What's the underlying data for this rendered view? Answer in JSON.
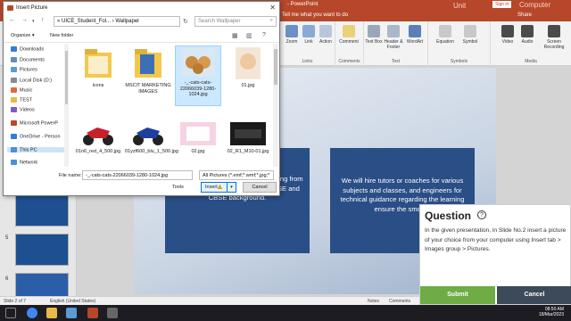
{
  "powerpoint": {
    "title": "- PowerPoint",
    "unit_text": "Unit",
    "brand_text": "Computer Education",
    "sign_in": "Sign in",
    "tell_me": "Tell me what you want to do",
    "share": "Share"
  },
  "ribbon": {
    "links_group": "Links",
    "comments_group": "Comments",
    "text_group": "Text",
    "symbols_group": "Symbols",
    "media_group": "Media",
    "buttons": {
      "zoom": "Zoom",
      "link": "Link",
      "action": "Action",
      "comment": "Comment",
      "textbox": "Text Box",
      "header_footer": "Header & Footer",
      "wordart": "WordArt",
      "equation": "Equation",
      "symbol": "Symbol",
      "video": "Video",
      "audio": "Audio",
      "screen_recording": "Screen Recording"
    }
  },
  "thumbnails": {
    "numbers": [
      "4",
      "5",
      "6"
    ]
  },
  "slide": {
    "left_text": "class mic aspirants of all ages, starting from Standard I to Standard XII from ICSE and CBSE background.",
    "right_text": "We will hire tutors or coaches for various subjects and classes, and engineers for technical guidance regarding the learning ensure the smooth"
  },
  "statusbar": {
    "slide_of": "Slide 2 of 7",
    "language": "English (United States)",
    "notes": "Notes",
    "comments": "Comments"
  },
  "taskbar": {
    "time": "08:50 AM",
    "date": "18/Mar/2023"
  },
  "dialog": {
    "title": "Insert Picture",
    "close_glyph": "✕",
    "address": "« UICE_Student_Fol... › Wallpaper",
    "search_placeholder": "Search Wallpaper",
    "organize": "Organize ▾",
    "new_folder": "New folder",
    "nav_items": [
      {
        "label": "Downloads",
        "color": "#2f7ed8"
      },
      {
        "label": "Documents",
        "color": "#6a8ab5"
      },
      {
        "label": "Pictures",
        "color": "#5a9bd4"
      },
      {
        "label": "Local Disk (D:)",
        "color": "#8a8a8a"
      },
      {
        "label": "Music",
        "color": "#e06a3a"
      },
      {
        "label": "TEST",
        "color": "#e9b949"
      },
      {
        "label": "Videos",
        "color": "#7a5cc7"
      },
      {
        "label": "Microsoft PowerP",
        "color": "#b7472a"
      },
      {
        "label": "OneDrive - Person",
        "color": "#2f7ed8"
      },
      {
        "label": "This PC",
        "color": "#4a90d9"
      },
      {
        "label": "Network",
        "color": "#4a90d9"
      }
    ],
    "files": [
      {
        "name": "icons"
      },
      {
        "name": "MSCIT MARKETING IMAGES"
      },
      {
        "name": "-_-cats-cats-22066039-1280-1024.jpg"
      },
      {
        "name": "01.jpg"
      },
      {
        "name": "01n6_red_4_500.jpg"
      },
      {
        "name": "01yzf600_blu_1_500.jpg"
      },
      {
        "name": "02.jpg"
      },
      {
        "name": "02_R1_M10-01.jpg"
      }
    ],
    "file_name_label": "File name:",
    "file_name_value": "-_-cats-cats-22066039-1280-1024.jpg",
    "filter_value": "All Pictures (*.emf;*.wmf;*.jpg;*",
    "tools": "Tools",
    "insert": "Insert",
    "cancel": "Cancel"
  },
  "question": {
    "title": "Question",
    "help": "?",
    "body": "In the given presentation, in Slide No.2 insert a picture of your choice from your computer using Insert tab > Images group > Pictures.",
    "submit": "Submit",
    "cancel": "Cancel"
  },
  "colors": {
    "ppt_red": "#b7472a",
    "slide_box": "#2a4e86",
    "submit_green": "#6fac46",
    "cancel_dark": "#3c4a5a"
  }
}
